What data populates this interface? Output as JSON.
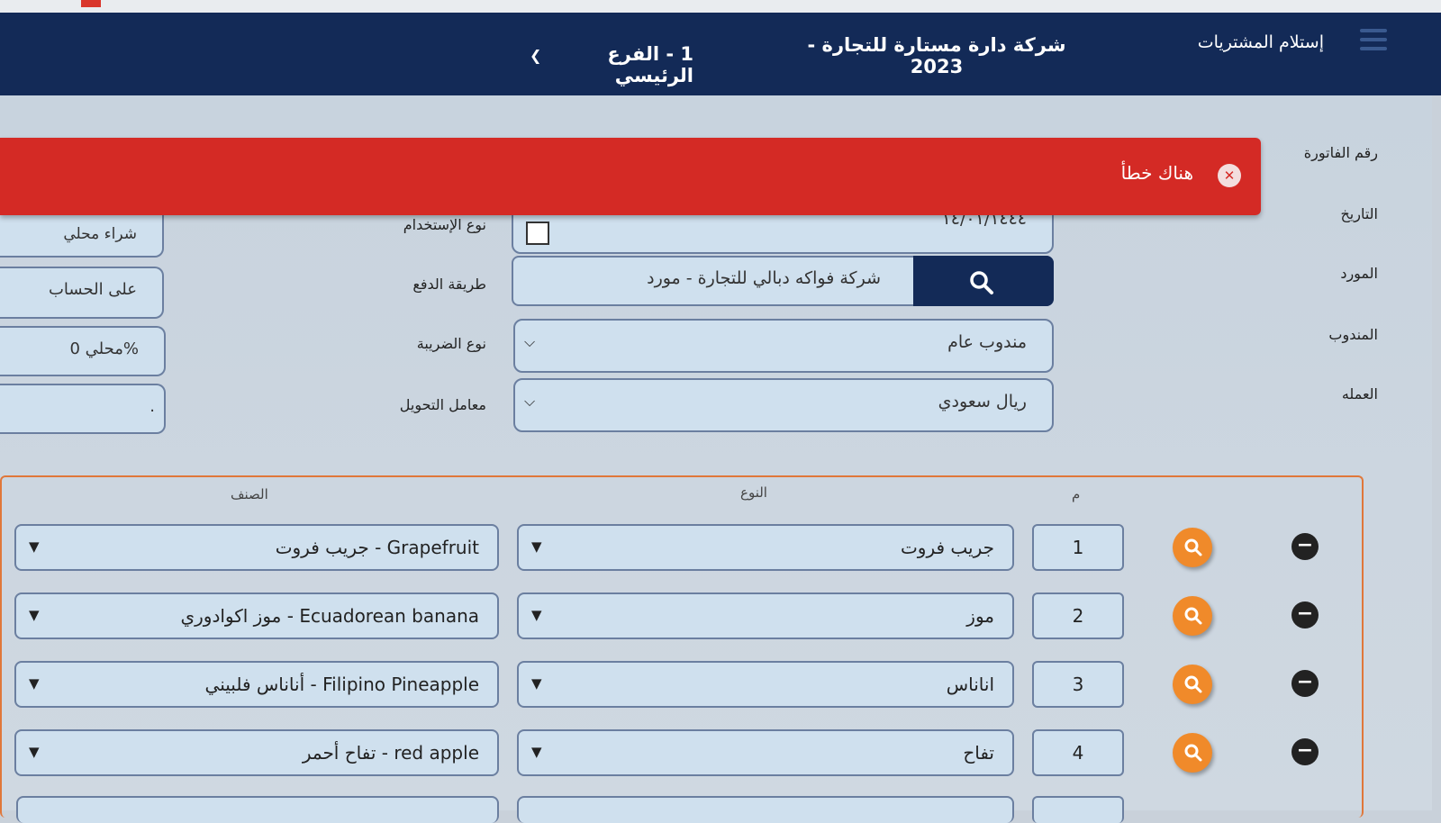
{
  "header": {
    "title": "إستلام المشتريات",
    "company": "شركة دارة مستارة للتجارة - 2023",
    "branch": "1 - الفرع الرئيسي"
  },
  "form": {
    "labels": {
      "invoice_no": "رقم الفاتورة",
      "date": "التاريخ",
      "supplier": "المورد",
      "representative": "المندوب",
      "currency": "العمله",
      "usage_type": "نوع الإستخدام",
      "payment_method": "طريقة الدفع",
      "tax_type": "نوع الضريبة",
      "conversion_rate": "معامل التحويل"
    },
    "values": {
      "date": "١٤/٠١/١٤٤٤",
      "supplier": "شركة فواكه دبالي للتجارة - مورد",
      "representative": "مندوب عام",
      "currency": "ريال سعودي",
      "usage_type": "شراء محلي",
      "payment_method": "على الحساب",
      "tax_type": "%محلي 0",
      "conversion_rate": "."
    }
  },
  "error": {
    "message": "هناك خطأ"
  },
  "grid": {
    "headers": {
      "index": "م",
      "type": "النوع",
      "item": "الصنف"
    },
    "rows": [
      {
        "index": "1",
        "type": "جريب فروت",
        "item": "Grapefruit - جريب فروت"
      },
      {
        "index": "2",
        "type": "موز",
        "item": "Ecuadorean banana - موز اكوادوري"
      },
      {
        "index": "3",
        "type": "اناناس",
        "item": "Filipino Pineapple - أناناس فلبيني"
      },
      {
        "index": "4",
        "type": "تفاح",
        "item": "red apple - تفاح أحمر"
      }
    ]
  },
  "colors": {
    "header_bg": "#132a57",
    "error_bg": "#d42a25",
    "accent_orange": "#f08a2a"
  }
}
